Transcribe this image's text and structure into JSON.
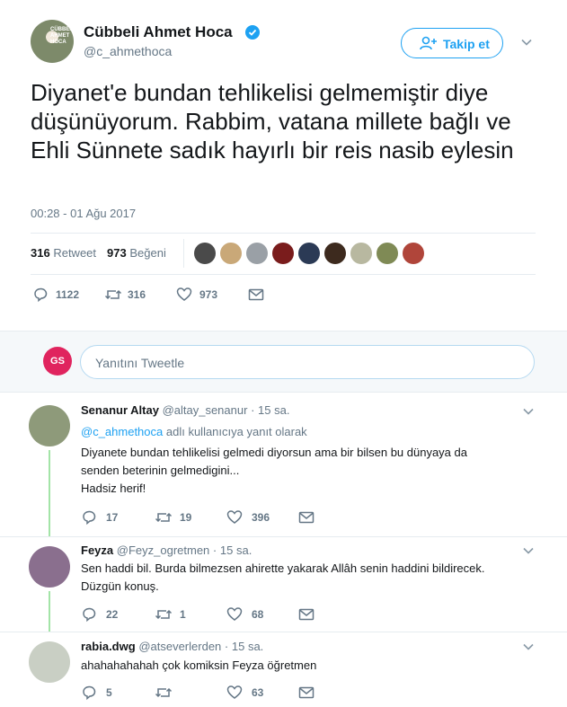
{
  "tweet": {
    "author_name": "Cübbeli Ahmet Hoca",
    "author_handle": "@c_ahmethoca",
    "avatar_text": "CÜBBELİ AHMET HOCA",
    "follow_label": "Takip et",
    "text": "Diyanet'e bundan tehlikelisi gelmemiştir diye düşünüyorum. Rabbim, vatana millete bağlı ve Ehli Sünnete sadık hayırlı bir reis nasib eylesin",
    "timestamp": "00:28 - 01 Ağu 2017",
    "retweet_count": "316",
    "retweet_label": "Retweet",
    "like_count": "973",
    "like_label": "Beğeni",
    "actions": {
      "replies": "1122",
      "retweets": "316",
      "likes": "973"
    },
    "liker_avatar_colors": [
      "#4a4a4a",
      "#c9a878",
      "#9aa0a6",
      "#7a1c1c",
      "#2b3a55",
      "#3d2a1e",
      "#b8b8a0",
      "#7f8a55",
      "#b0453a"
    ]
  },
  "reply_box": {
    "avatar_text": "GS",
    "placeholder": "Yanıtını Tweetle"
  },
  "replies": [
    {
      "name": "Senanur Altay",
      "handle": "@altay_senanur",
      "dot": "·",
      "time": "15 sa.",
      "reply_to_mention": "@c_ahmethoca",
      "reply_to_suffix": "adlı kullanıcıya yanıt olarak",
      "text_lines": [
        "Diyanete bundan tehlikelisi gelmedi diyorsun ama bir bilsen bu dünyaya da",
        "senden beterinin gelmedigini...",
        "Hadsiz herif!"
      ],
      "replies": "17",
      "retweets": "19",
      "likes": "396",
      "avatar_color": "#8e9a7a"
    },
    {
      "name": "Feyza",
      "handle": "@Feyz_ogretmen",
      "dot": "·",
      "time": "15 sa.",
      "text_lines": [
        "Sen haddi bil. Burda bilmezsen ahirette yakarak Allâh senin haddini bildirecek.",
        "Düzgün konuş."
      ],
      "replies": "22",
      "retweets": "1",
      "likes": "68",
      "avatar_color": "#8a6f8e"
    },
    {
      "name": "rabia.dwg",
      "handle": "@atseverlerden",
      "dot": "·",
      "time": "15 sa.",
      "text_lines": [
        "ahahahahahah çok komiksin Feyza öğretmen"
      ],
      "replies": "5",
      "retweets": "",
      "likes": "63",
      "avatar_color": "#c9cfc4"
    }
  ],
  "colors": {
    "accent": "#1da1f2",
    "thread_line": "#a3e4a7",
    "muted_text": "#657786"
  }
}
